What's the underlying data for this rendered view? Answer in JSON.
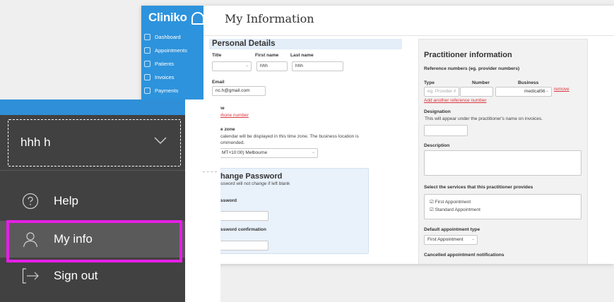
{
  "app": {
    "logo_text": "Cliniko",
    "page_title": "My Information",
    "sidebar": {
      "items": [
        {
          "label": "Dashboard"
        },
        {
          "label": "Appointments"
        },
        {
          "label": "Patients"
        },
        {
          "label": "Invoices"
        },
        {
          "label": "Payments"
        }
      ]
    },
    "personal": {
      "title": "Personal Details",
      "title_label": "Title",
      "first_name_label": "First name",
      "first_name_value": "hhh",
      "last_name_label": "Last name",
      "last_name_value": "hhh",
      "email_label": "Email",
      "email_value": "nc.h@gmail.com",
      "phone_label": "ne",
      "add_phone": "phone number",
      "timezone_label": "e zone",
      "timezone_help_1": "calendar will be displayed in this time zone. The business location is",
      "timezone_help_2": "ommended.",
      "timezone_value": "MT+10:00) Melbourne"
    },
    "password": {
      "title": "Change Password",
      "subtitle": "ssword will not change if left blank",
      "password_label": "ssword",
      "confirm_label": "ssword confirmation"
    },
    "practitioner": {
      "title": "Practitioner information",
      "ref_label": "Reference numbers (eg. provider numbers)",
      "col_type": "Type",
      "col_number": "Number",
      "col_business": "Business",
      "type_placeholder": "eg. Provider #",
      "business_value": "medical56",
      "remove_link": "remove",
      "add_ref_link": "Add another reference number",
      "designation_label": "Designation",
      "designation_help": "This will appear under the practitioner's name on invoices.",
      "description_label": "Description",
      "services_label": "Select the services that this practitioner provides",
      "services": [
        "First Appointment",
        "Standard Appointment"
      ],
      "default_appt_label": "Default appointment type",
      "default_appt_value": "First Appointment",
      "cancelled_label": "Cancelled appointment notifications"
    }
  },
  "popup": {
    "user_name": "hhh h",
    "menu": [
      {
        "label": "Help",
        "icon": "help-circle-icon"
      },
      {
        "label": "My info",
        "icon": "user-icon"
      },
      {
        "label": "Sign out",
        "icon": "sign-out-icon"
      }
    ],
    "highlight_color": "#e61ee6",
    "accent_color": "#2f8fd8"
  }
}
